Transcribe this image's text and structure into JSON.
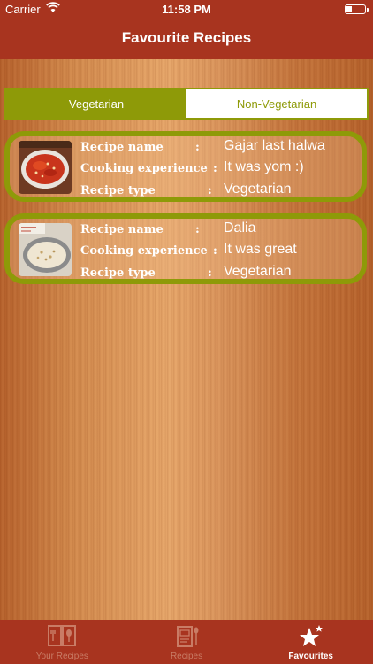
{
  "status": {
    "carrier": "Carrier",
    "time": "11:58 PM"
  },
  "nav": {
    "title": "Favourite Recipes"
  },
  "segments": [
    {
      "label": "Vegetarian",
      "active": true
    },
    {
      "label": "Non-Vegetarian",
      "active": false
    }
  ],
  "labels": {
    "name": "Recipe name",
    "experience": "Cooking experience",
    "type": "Recipe type",
    "colon": ":"
  },
  "recipes": [
    {
      "name": "Gajar last halwa",
      "experience": "It was yom :)",
      "type": "Vegetarian",
      "thumb": "carrot-halwa-photo"
    },
    {
      "name": "Dalia",
      "experience": "It was great",
      "type": "Vegetarian",
      "thumb": "dalia-porridge-photo"
    }
  ],
  "tabs": [
    {
      "label": "Your Recipes",
      "icon": "book-spoon-icon",
      "active": false
    },
    {
      "label": "Recipes",
      "icon": "recipe-book-icon",
      "active": false
    },
    {
      "label": "Favourites",
      "icon": "stars-icon",
      "active": true
    }
  ],
  "colors": {
    "nav": "#a8341f",
    "accent": "#8e9a08"
  }
}
